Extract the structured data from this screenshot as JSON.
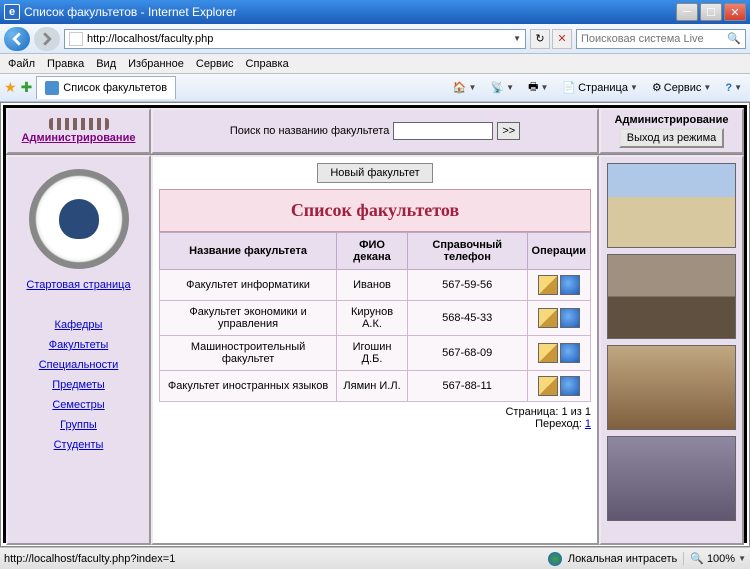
{
  "window": {
    "title": "Список факультетов - Internet Explorer"
  },
  "browser": {
    "url": "http://localhost/faculty.php",
    "search_placeholder": "Поисковая система Live",
    "menu": {
      "file": "Файл",
      "edit": "Правка",
      "view": "Вид",
      "favorites": "Избранное",
      "tools": "Сервис",
      "help": "Справка"
    },
    "tab_title": "Список факультетов",
    "cmd": {
      "page": "Страница",
      "service": "Сервис"
    }
  },
  "page": {
    "admin_link": "Администрирование",
    "search_label": "Поиск по названию факультета",
    "search_go": ">>",
    "admin_box_title": "Администрирование",
    "logout_btn": "Выход из режима",
    "start_link": "Стартовая страница",
    "nav": {
      "departments": "Кафедры",
      "faculties": "Факультеты",
      "specialties": "Специальности",
      "subjects": "Предметы",
      "semesters": "Семестры",
      "groups": "Группы",
      "students": "Студенты"
    },
    "new_btn": "Новый факультет",
    "list_title": "Список факультетов",
    "columns": {
      "name": "Название факультета",
      "dean": "ФИО декана",
      "phone": "Справочный телефон",
      "ops": "Операции"
    },
    "rows": [
      {
        "name": "Факультет информатики",
        "dean": "Иванов",
        "phone": "567-59-56"
      },
      {
        "name": "Факультет экономики и управления",
        "dean": "Кирунов А.К.",
        "phone": "568-45-33"
      },
      {
        "name": "Машиностроительный факультет",
        "dean": "Игошин Д.Б.",
        "phone": "567-68-09"
      },
      {
        "name": "Факультет иностранных языков",
        "dean": "Лямин И.Л.",
        "phone": "567-88-11"
      }
    ],
    "pager_page": "Страница: 1 из 1",
    "pager_goto_label": "Переход:",
    "pager_goto_link": "1"
  },
  "status": {
    "left": "http://localhost/faculty.php?index=1",
    "zone": "Локальная интрасеть",
    "zoom": "100%"
  }
}
